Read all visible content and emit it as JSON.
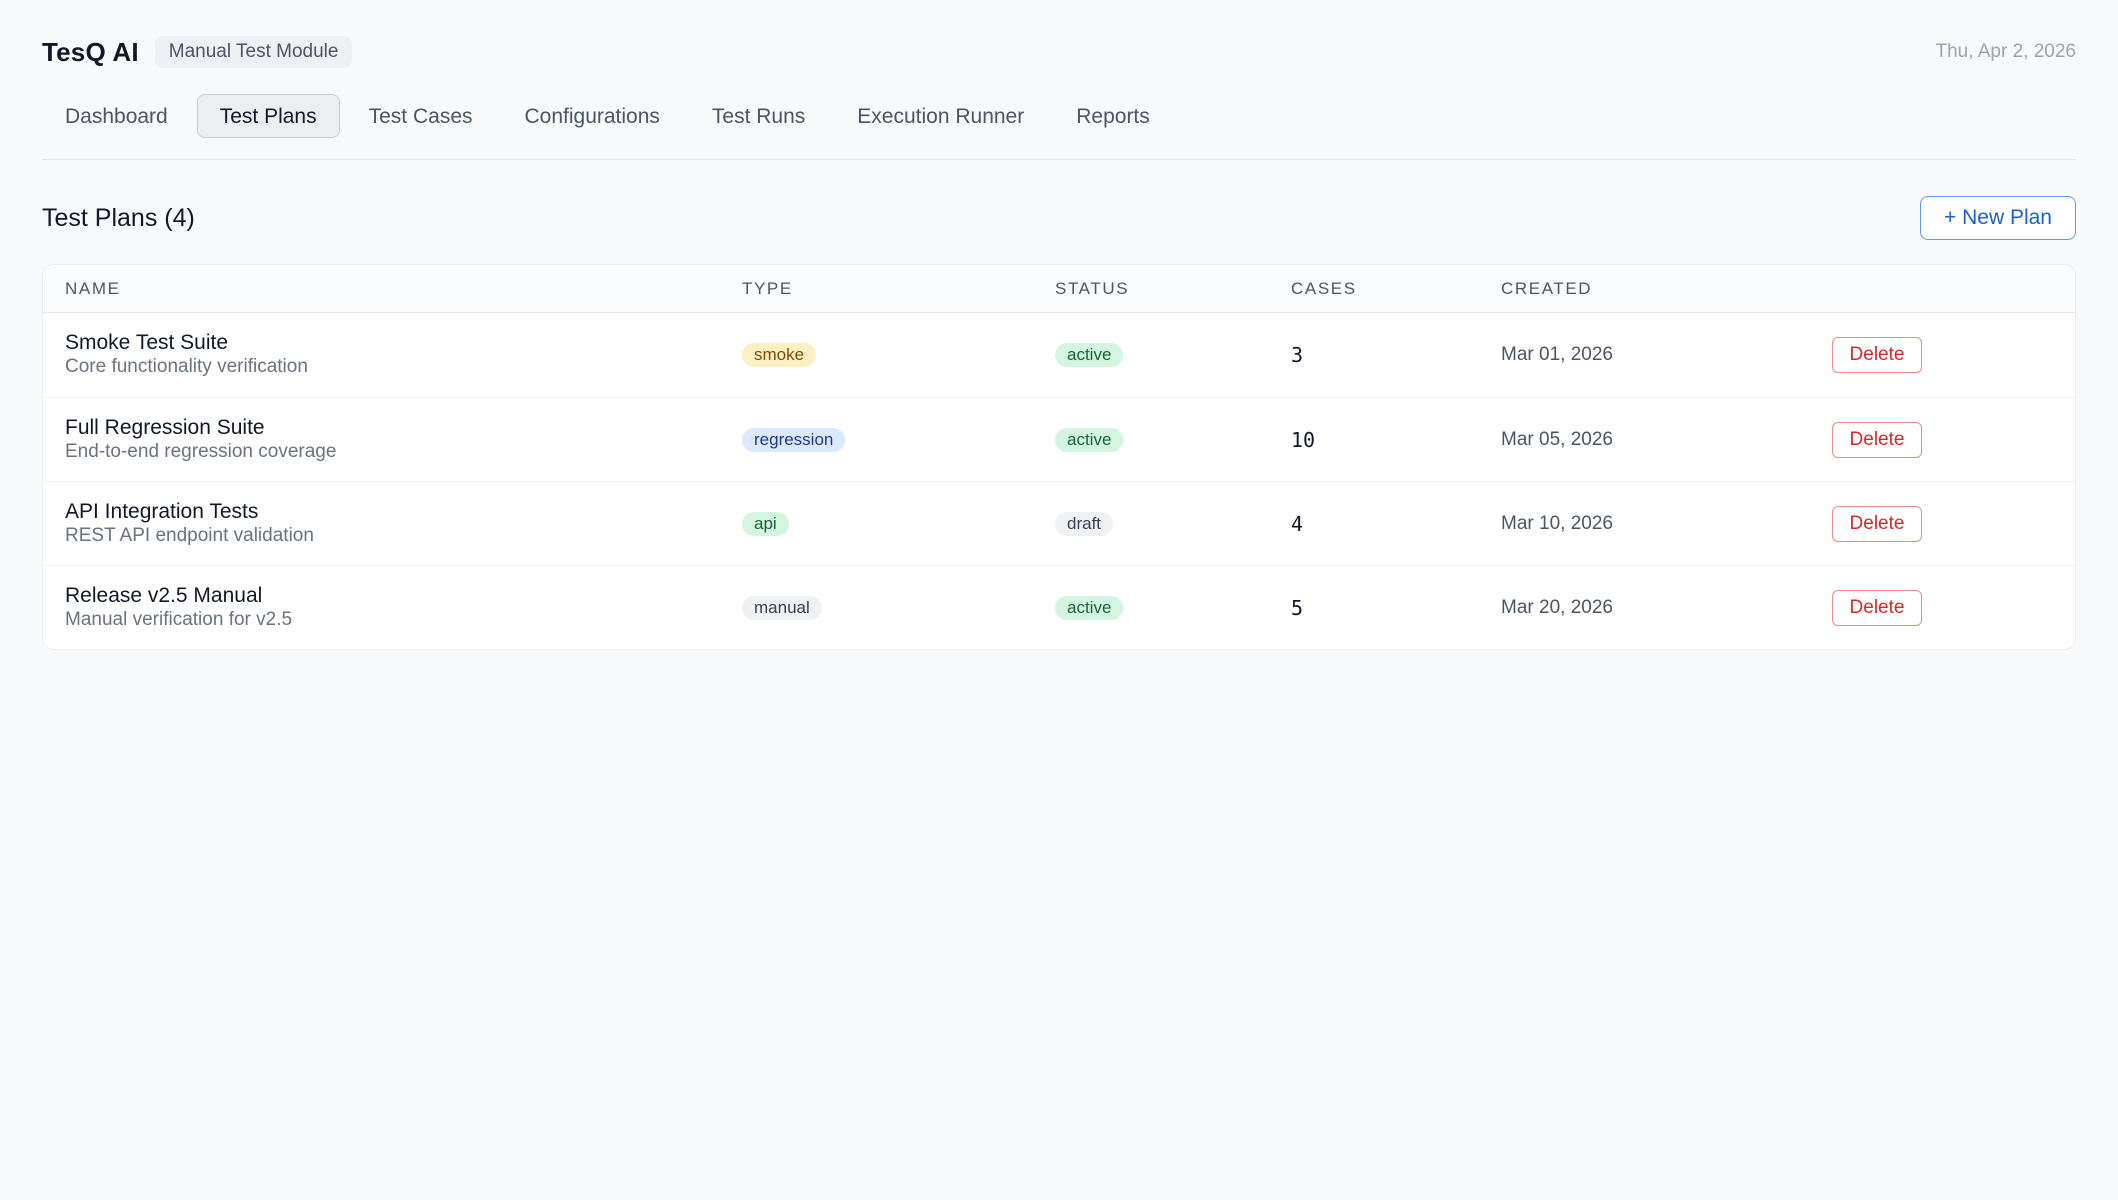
{
  "header": {
    "app_title": "TesQ AI",
    "module_badge": "Manual Test Module",
    "date": "Thu, Apr 2, 2026"
  },
  "nav": {
    "tabs": [
      {
        "label": "Dashboard",
        "active": false
      },
      {
        "label": "Test Plans",
        "active": true
      },
      {
        "label": "Test Cases",
        "active": false
      },
      {
        "label": "Configurations",
        "active": false
      },
      {
        "label": "Test Runs",
        "active": false
      },
      {
        "label": "Execution Runner",
        "active": false
      },
      {
        "label": "Reports",
        "active": false
      }
    ]
  },
  "section": {
    "title": "Test Plans (4)",
    "new_plan_label": "+ New Plan"
  },
  "table": {
    "columns": [
      "NAME",
      "TYPE",
      "STATUS",
      "CASES",
      "CREATED"
    ],
    "delete_label": "Delete",
    "rows": [
      {
        "name": "Smoke Test Suite",
        "description": "Core functionality verification",
        "type": "smoke",
        "status": "active",
        "cases": "3",
        "created": "Mar 01, 2026"
      },
      {
        "name": "Full Regression Suite",
        "description": "End-to-end regression coverage",
        "type": "regression",
        "status": "active",
        "cases": "10",
        "created": "Mar 05, 2026"
      },
      {
        "name": "API Integration Tests",
        "description": "REST API endpoint validation",
        "type": "api",
        "status": "draft",
        "cases": "4",
        "created": "Mar 10, 2026"
      },
      {
        "name": "Release v2.5 Manual",
        "description": "Manual verification for v2.5",
        "type": "manual",
        "status": "active",
        "cases": "5",
        "created": "Mar 20, 2026"
      }
    ]
  },
  "colors": {
    "accent": "#1d5fd1",
    "danger": "#dc2626",
    "background": "#f8f9fb"
  }
}
